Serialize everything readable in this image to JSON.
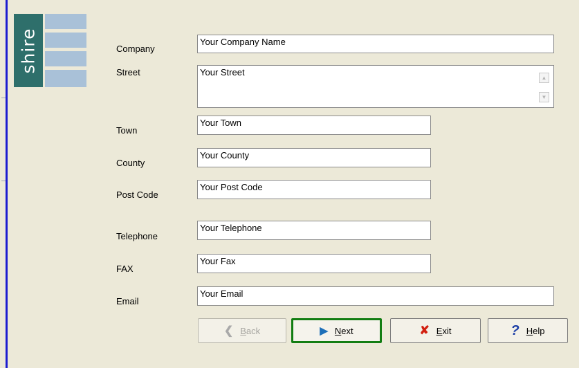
{
  "logo": {
    "text": "shire"
  },
  "form": {
    "company": {
      "label": "Company",
      "value": "Your Company Name"
    },
    "street": {
      "label": "Street",
      "value": "Your Street"
    },
    "town": {
      "label": "Town",
      "value": "Your Town"
    },
    "county": {
      "label": "County",
      "value": "Your County"
    },
    "postcode": {
      "label": "Post Code",
      "value": "Your Post Code"
    },
    "telephone": {
      "label": "Telephone",
      "value": "Your Telephone"
    },
    "fax": {
      "label": "FAX",
      "value": "Your Fax"
    },
    "email": {
      "label": "Email",
      "value": "Your Email"
    }
  },
  "buttons": {
    "back": {
      "mnemonic": "B",
      "rest": "ack",
      "icon": "back-arrow-icon",
      "enabled": false
    },
    "next": {
      "mnemonic": "N",
      "rest": "ext",
      "icon": "next-arrow-icon",
      "enabled": true,
      "focused": true
    },
    "exit": {
      "mnemonic": "E",
      "rest": "xit",
      "icon": "red-x-icon",
      "enabled": true
    },
    "help": {
      "mnemonic": "H",
      "rest": "elp",
      "icon": "question-mark-icon",
      "enabled": true
    }
  },
  "colors": {
    "focus_border": "#127d12",
    "window_bg": "#ece9d8",
    "logo_dark": "#2e6f6b",
    "logo_light": "#a9c1d8"
  }
}
